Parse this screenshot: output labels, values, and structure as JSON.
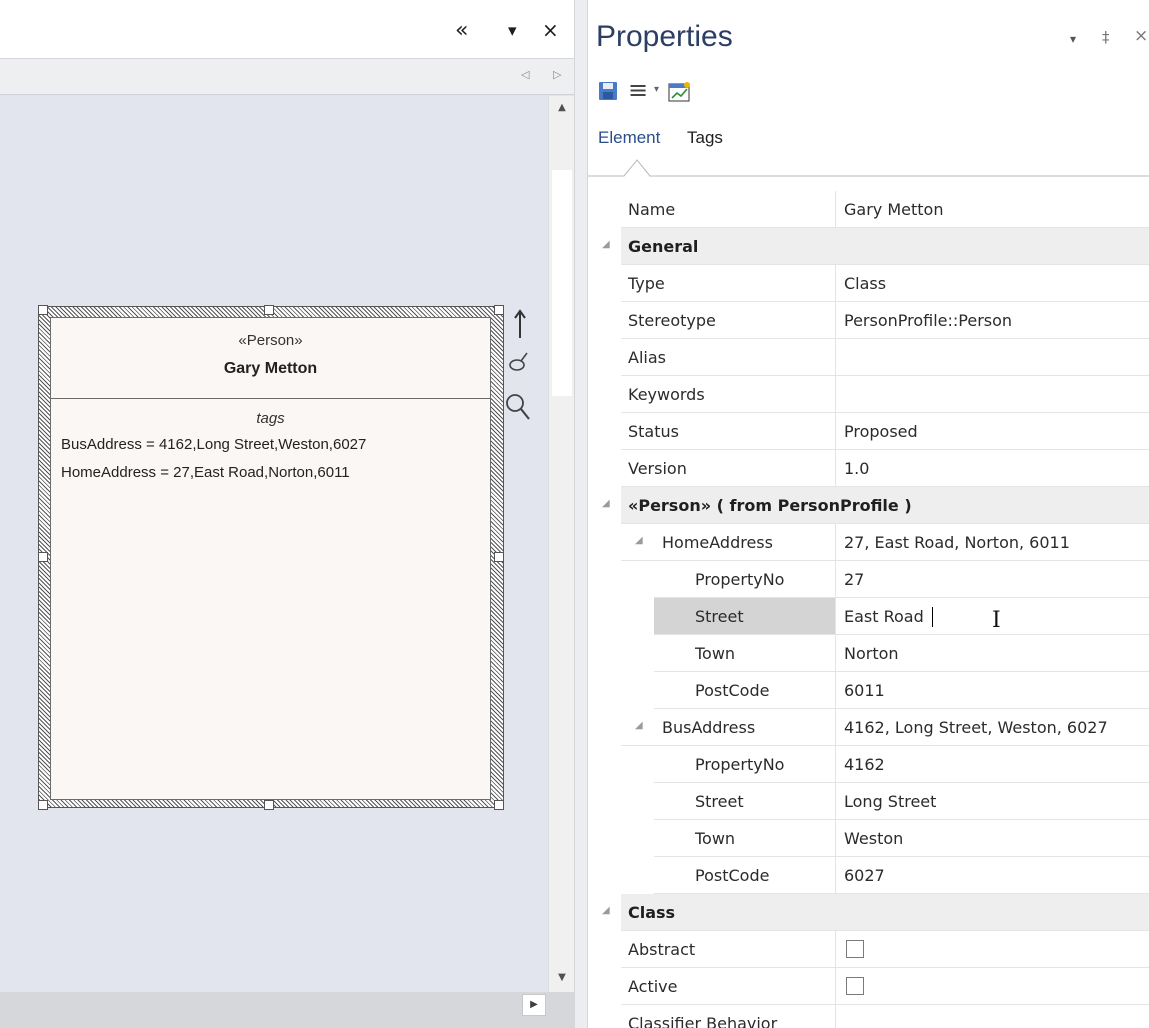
{
  "left_panel": {
    "titlebar": {
      "collapse_glyph": "«",
      "dropdown_glyph": "▾",
      "close_glyph": "×"
    },
    "nav": {
      "back_glyph": "◁",
      "forward_glyph": "▷"
    },
    "scroll": {
      "up_glyph": "▲",
      "down_glyph": "▼",
      "right_glyph": "▶"
    },
    "element": {
      "stereotype": "«Person»",
      "name": "Gary Metton",
      "tags_heading": "tags",
      "tags": [
        "BusAddress = 4162,Long Street,Weston,6027",
        "HomeAddress = 27,East Road,Norton,6011"
      ]
    },
    "quick_actions": {
      "link_glyph": "🡑",
      "format_glyph": "♂",
      "zoom_glyph": "🔍"
    }
  },
  "properties": {
    "title": "Properties",
    "header": {
      "dropdown_glyph": "▾",
      "pin_glyph": "‡",
      "close_glyph": "×"
    },
    "toolbar": {
      "menu_glyph": "≡",
      "menu_dropdown_glyph": "▾"
    },
    "tabs": {
      "element": "Element",
      "tags": "Tags"
    },
    "rows": [
      {
        "label": "Name",
        "value": "Gary Metton"
      },
      {
        "label": "General",
        "group": true
      },
      {
        "label": "Type",
        "value": "Class"
      },
      {
        "label": "Stereotype",
        "value": "PersonProfile::Person"
      },
      {
        "label": "Alias",
        "value": ""
      },
      {
        "label": "Keywords",
        "value": ""
      },
      {
        "label": "Status",
        "value": "Proposed"
      },
      {
        "label": "Version",
        "value": "1.0"
      },
      {
        "label": "«Person»  ( from PersonProfile )",
        "group": true
      },
      {
        "label": "HomeAddress",
        "value": "27, East Road, Norton, 6011"
      },
      {
        "label": "PropertyNo",
        "value": "27"
      },
      {
        "label": "Street",
        "value": "East Road"
      },
      {
        "label": "Town",
        "value": "Norton"
      },
      {
        "label": "PostCode",
        "value": "6011"
      },
      {
        "label": "BusAddress",
        "value": "4162, Long Street, Weston, 6027"
      },
      {
        "label": "PropertyNo",
        "value": "4162"
      },
      {
        "label": "Street",
        "value": "Long Street"
      },
      {
        "label": "Town",
        "value": "Weston"
      },
      {
        "label": "PostCode",
        "value": "6027"
      },
      {
        "label": "Class",
        "group": true
      },
      {
        "label": "Abstract",
        "checked": false
      },
      {
        "label": "Active",
        "checked": false
      },
      {
        "label": "Classifier Behavior",
        "value": ""
      }
    ],
    "expander_glyph": "◢",
    "cursor_glyph": "I"
  }
}
